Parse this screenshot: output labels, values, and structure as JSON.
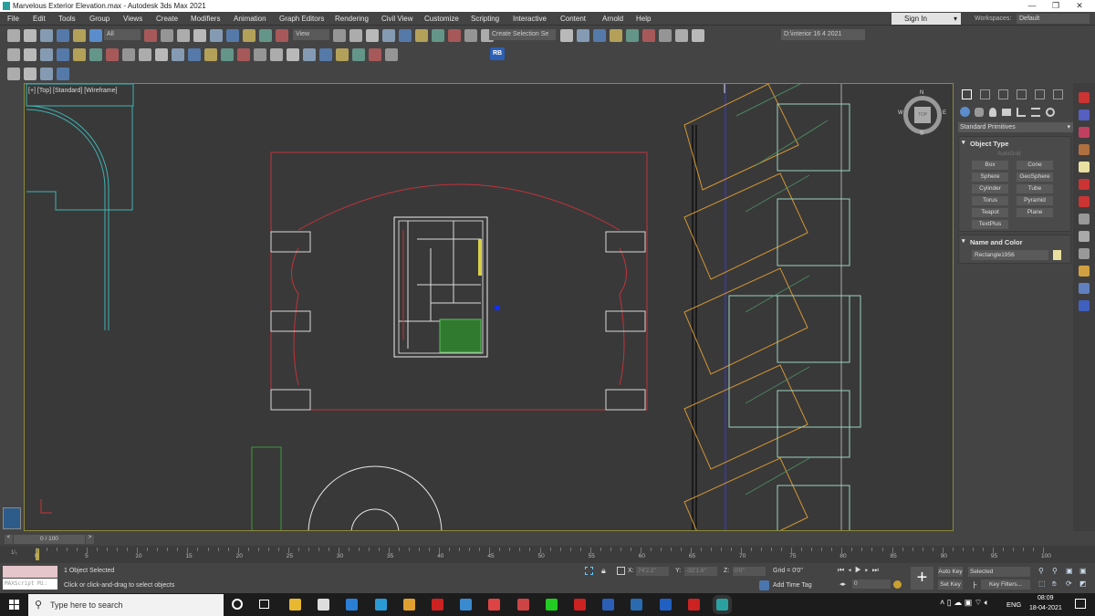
{
  "window": {
    "title": "Marvelous Exterior Elevation.max - Autodesk 3ds Max 2021",
    "minimize": "—",
    "restore": "❐",
    "close": "✕"
  },
  "menu": [
    "File",
    "Edit",
    "Tools",
    "Group",
    "Views",
    "Create",
    "Modifiers",
    "Animation",
    "Graph Editors",
    "Rendering",
    "Civil View",
    "Customize",
    "Scripting",
    "Interactive",
    "Content",
    "Arnold",
    "Help"
  ],
  "account": {
    "sign_in": "Sign In",
    "workspaces_label": "Workspaces:",
    "workspace": "Default"
  },
  "toolbar": {
    "selection_filter": "All",
    "ref_coord": "View",
    "named_selection": "Create Selection Se",
    "project_path": "D:\\interior 16 4 2021",
    "ribbon_button": "RB",
    "row1_icons": [
      "undo-icon",
      "redo-icon",
      "link-icon",
      "unlink-icon",
      "bind-space-warp-icon",
      "select-object-icon",
      "select-by-name-icon",
      "rect-selection-icon",
      "window-crossing-icon",
      "move-icon",
      "rotate-icon",
      "scale-icon",
      "placement-icon",
      "pivot-icon",
      "snaps-toggle-icon",
      "angle-snap-icon",
      "percent-snap-icon",
      "spinner-snap-icon",
      "edit-named-selection-icon",
      "mirror-icon",
      "align-icon",
      "scene-explorer-icon",
      "layer-explorer-icon",
      "toggle-ribbon-icon",
      "curve-editor-icon",
      "schematic-view-icon",
      "material-editor-icon",
      "render-setup-icon",
      "rendered-frame-icon",
      "render-icon",
      "project-folder-icon",
      "project-open-icon",
      "project-settings-icon",
      "project-create-icon"
    ],
    "row2_icons": [
      "teapot-icon",
      "viewport-icon",
      "frame-icon",
      "light-icon",
      "camera-tool-icon",
      "camera-icon",
      "box-icon",
      "sphere-icon",
      "geosphere-icon",
      "teapot2-icon",
      "cone-icon",
      "sun-icon",
      "torus-icon",
      "grid-icon",
      "particle-icon",
      "mesh-icon",
      "gear-icon",
      "plant-icon",
      "material-sphere-icon",
      "color-palette-icon",
      "scene-icon",
      "light-blue-icon",
      "clipboard-icon",
      "help-icon"
    ],
    "row3_icons": [
      "fp-plugin-icon",
      "forest-icon",
      "tools-icon",
      "spreadsheet-icon"
    ]
  },
  "viewport": {
    "label": "[+] [Top] [Standard] [Wireframe]",
    "viewcube_face": "TOP",
    "compass": [
      "N",
      "E",
      "S",
      "W"
    ]
  },
  "command_panel": {
    "tabs": [
      "create-icon",
      "modify-icon",
      "hierarchy-icon",
      "motion-icon",
      "display-icon",
      "utilities-icon"
    ],
    "category": "Standard Primitives",
    "object_type_title": "Object Type",
    "autogrid": "AutoGrid",
    "buttons": [
      "Box",
      "Cone",
      "Sphere",
      "GeoSphere",
      "Cylinder",
      "Tube",
      "Torus",
      "Pyramid",
      "Teapot",
      "Plane",
      "TextPlus"
    ],
    "name_color_title": "Name and Color",
    "object_name": "Rectangle1956",
    "object_color": "#e8e0a0"
  },
  "timeline": {
    "frame": "0 / 100",
    "ticks": [
      "0",
      "5",
      "10",
      "15",
      "20",
      "25",
      "30",
      "35",
      "40",
      "45",
      "50",
      "55",
      "60",
      "65",
      "70",
      "75",
      "80",
      "85",
      "90",
      "95",
      "100"
    ],
    "current_frame": 0
  },
  "status": {
    "selection": "1 Object Selected",
    "prompt": "Click or click-and-drag to select objects",
    "maxscript": "MAXScript Mi:",
    "x": "74'2.2\"",
    "y": "-32'1.6\"",
    "z": "0'0\"",
    "grid": "Grid = 0'0\"",
    "add_time_tag": "Add Time Tag",
    "frame_value": "0",
    "auto_key": "Auto Key",
    "set_key": "Set Key",
    "key_mode": "Selected",
    "key_filters": "Key Filters..."
  },
  "taskbar": {
    "search_placeholder": "Type here to search",
    "language": "ENG",
    "time": "08:09",
    "date": "18-04-2021",
    "apps": [
      "file-explorer-icon",
      "store-icon",
      "mail-icon",
      "edge-icon",
      "chrome-icon",
      "autocad-icon",
      "app-icon",
      "sketch-icon",
      "app2-icon",
      "whatsapp-icon",
      "pinterest-icon",
      "word-icon",
      "photoshop-icon",
      "photoshop2-icon",
      "sketchup-icon",
      "3dsmax-icon"
    ]
  },
  "colors": {
    "accent": "#5b8ccc",
    "viewport_bg": "#393939",
    "active_border": "#8a8a3a"
  }
}
